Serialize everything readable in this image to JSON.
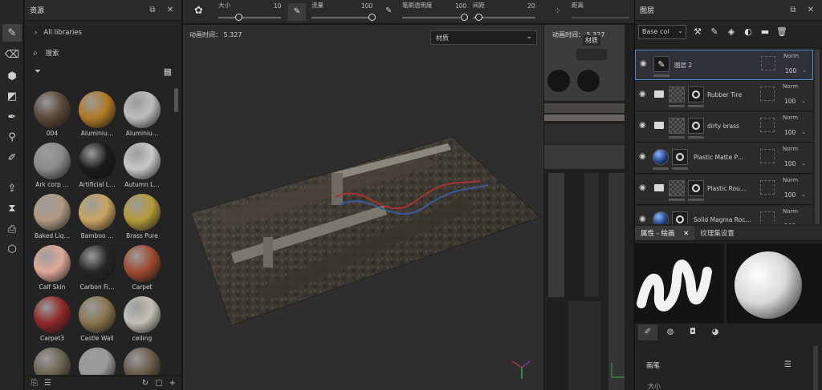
{
  "toolbar": {
    "tools": [
      {
        "name": "paint-tool",
        "glyph": "✎",
        "active": true
      },
      {
        "name": "eraser-tool",
        "glyph": "⌫"
      },
      {
        "name": "projection-tool",
        "glyph": "⬢"
      },
      {
        "name": "polygon-fill-tool",
        "glyph": "◩"
      },
      {
        "name": "smudge-tool",
        "glyph": "✒"
      },
      {
        "name": "clone-tool",
        "glyph": "⚲"
      },
      {
        "name": "color-picker-tool",
        "glyph": "✐"
      },
      {
        "name": "bake-tool",
        "glyph": "⇪"
      },
      {
        "name": "hourglass-tool",
        "glyph": "⧗"
      },
      {
        "name": "export-doc-tool",
        "glyph": "⎙"
      },
      {
        "name": "package-tool",
        "glyph": "⬡"
      }
    ]
  },
  "assets": {
    "title": "资源",
    "libraries_label": "All libraries",
    "search_label": "搜索",
    "materials": [
      {
        "label": "004",
        "color": "#5a4838"
      },
      {
        "label": "Aluminiu…",
        "color": "#b07a25"
      },
      {
        "label": "Aluminiu…",
        "color": "#bdbdbd"
      },
      {
        "label": "Ark corp …",
        "color": "#8a8a8a"
      },
      {
        "label": "Artificial L…",
        "color": "#1a1a1a"
      },
      {
        "label": "Autumn L…",
        "color": "#c8c8c8"
      },
      {
        "label": "Baked Liq…",
        "color": "#b09a82"
      },
      {
        "label": "Bamboo …",
        "color": "#c9a460"
      },
      {
        "label": "Brass Pure",
        "color": "#b39a3a"
      },
      {
        "label": "Calf Skin",
        "color": "#e0a898"
      },
      {
        "label": "Carbon Fi…",
        "color": "#262626"
      },
      {
        "label": "Carpet",
        "color": "#a04a30"
      },
      {
        "label": "Carpet3",
        "color": "#902828"
      },
      {
        "label": "Castle Wall",
        "color": "#8a7450"
      },
      {
        "label": "ceiling",
        "color": "#c4c0b8"
      },
      {
        "label": "",
        "color": "#6a6450"
      },
      {
        "label": "",
        "color": "#9a9a9a"
      },
      {
        "label": "",
        "color": "#6a5a4a"
      }
    ]
  },
  "topbar": {
    "size_label": "大小",
    "size_value": "10",
    "flow_label": "流量",
    "flow_value": "100",
    "opacity_label": "笔刷透明度",
    "opacity_value": "100",
    "spacing_label": "间距",
    "spacing_value": "20",
    "distance_label": "距离"
  },
  "viewport": {
    "anim_time": "动画时间：  5.327",
    "material_dropdown": "材质"
  },
  "uv_view": {
    "anim_time": "动画时间：  5.327",
    "material_label": "材质"
  },
  "layers": {
    "title": "图层",
    "channel": "Base col",
    "items": [
      {
        "name": "图层 2",
        "type": "paint",
        "mode": "Norm",
        "opacity": "100",
        "selected": true
      },
      {
        "name": "Rubber Tire",
        "type": "folder",
        "mode": "Norm",
        "opacity": "100"
      },
      {
        "name": "dirty brass",
        "type": "folder",
        "mode": "Norm",
        "opacity": "100"
      },
      {
        "name": "Plastic Matte P…",
        "type": "fill",
        "mode": "Norm",
        "opacity": "100"
      },
      {
        "name": "Plastic Rou…",
        "type": "folder",
        "mode": "Norm",
        "opacity": "100"
      },
      {
        "name": "Solid Magma Roc…",
        "type": "fill",
        "mode": "Norm",
        "opacity": "100"
      }
    ]
  },
  "properties": {
    "tab_active": "属性 - 绘画",
    "tab_other": "纹理集设置",
    "section": "画笔",
    "subsection": "大小"
  },
  "colors": {
    "accent": "#4f89c8",
    "panel": "#232323",
    "viewport": "#2e2e2e"
  }
}
